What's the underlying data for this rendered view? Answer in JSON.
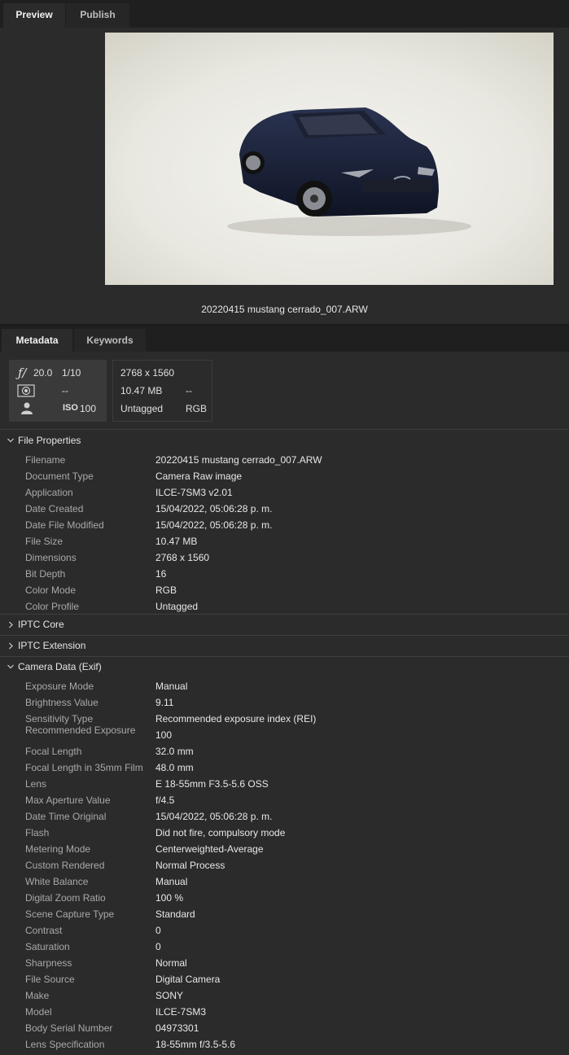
{
  "top_tabs": [
    "Preview",
    "Publish"
  ],
  "preview": {
    "filename": "20220415 mustang cerrado_007.ARW"
  },
  "meta_tabs": [
    "Metadata",
    "Keywords"
  ],
  "summary": {
    "aperture": "20.0",
    "shutter": "1/10",
    "metering": "--",
    "iso_label": "ISO",
    "iso": "100",
    "dimensions": "2768 x 1560",
    "size": "10.47 MB",
    "size_extra": "--",
    "profile": "Untagged",
    "mode": "RGB"
  },
  "sections": {
    "file": {
      "title": "File Properties",
      "rows": [
        {
          "k": "Filename",
          "v": "20220415 mustang cerrado_007.ARW"
        },
        {
          "k": "Document Type",
          "v": "Camera Raw image"
        },
        {
          "k": "Application",
          "v": "ILCE-7SM3 v2.01"
        },
        {
          "k": "Date Created",
          "v": "15/04/2022, 05:06:28 p. m."
        },
        {
          "k": "Date File Modified",
          "v": "15/04/2022, 05:06:28 p. m."
        },
        {
          "k": "File Size",
          "v": "10.47 MB"
        },
        {
          "k": "Dimensions",
          "v": "2768 x 1560"
        },
        {
          "k": "Bit Depth",
          "v": "16"
        },
        {
          "k": "Color Mode",
          "v": "RGB"
        },
        {
          "k": "Color Profile",
          "v": "Untagged"
        }
      ]
    },
    "iptc_core": {
      "title": "IPTC Core"
    },
    "iptc_ext": {
      "title": "IPTC Extension"
    },
    "camera": {
      "title": "Camera Data (Exif)",
      "rows": [
        {
          "k": "Exposure Mode",
          "v": "Manual"
        },
        {
          "k": "Brightness Value",
          "v": "9.11"
        },
        {
          "k": "Sensitivity Type",
          "v": "Recommended exposure index (REI)"
        },
        {
          "k": "Recommended Exposure",
          "v": "100"
        },
        {
          "k": "Focal Length",
          "v": "32.0 mm"
        },
        {
          "k": "Focal Length in 35mm Film",
          "v": "48.0 mm"
        },
        {
          "k": "Lens",
          "v": "E 18-55mm F3.5-5.6 OSS"
        },
        {
          "k": "Max Aperture Value",
          "v": "f/4.5"
        },
        {
          "k": "Date Time Original",
          "v": "15/04/2022, 05:06:28 p. m."
        },
        {
          "k": "Flash",
          "v": "Did not fire, compulsory mode"
        },
        {
          "k": "Metering Mode",
          "v": "Centerweighted-Average"
        },
        {
          "k": "Custom Rendered",
          "v": "Normal Process"
        },
        {
          "k": "White Balance",
          "v": "Manual"
        },
        {
          "k": "Digital Zoom Ratio",
          "v": "100 %"
        },
        {
          "k": "Scene Capture Type",
          "v": "Standard"
        },
        {
          "k": "Contrast",
          "v": "0"
        },
        {
          "k": "Saturation",
          "v": "0"
        },
        {
          "k": "Sharpness",
          "v": "Normal"
        },
        {
          "k": "File Source",
          "v": "Digital Camera"
        },
        {
          "k": "Make",
          "v": "SONY"
        },
        {
          "k": "Model",
          "v": "ILCE-7SM3"
        },
        {
          "k": "Body Serial Number",
          "v": "04973301"
        },
        {
          "k": "Lens Specification",
          "v": "18-55mm f/3.5-5.6"
        }
      ]
    }
  }
}
